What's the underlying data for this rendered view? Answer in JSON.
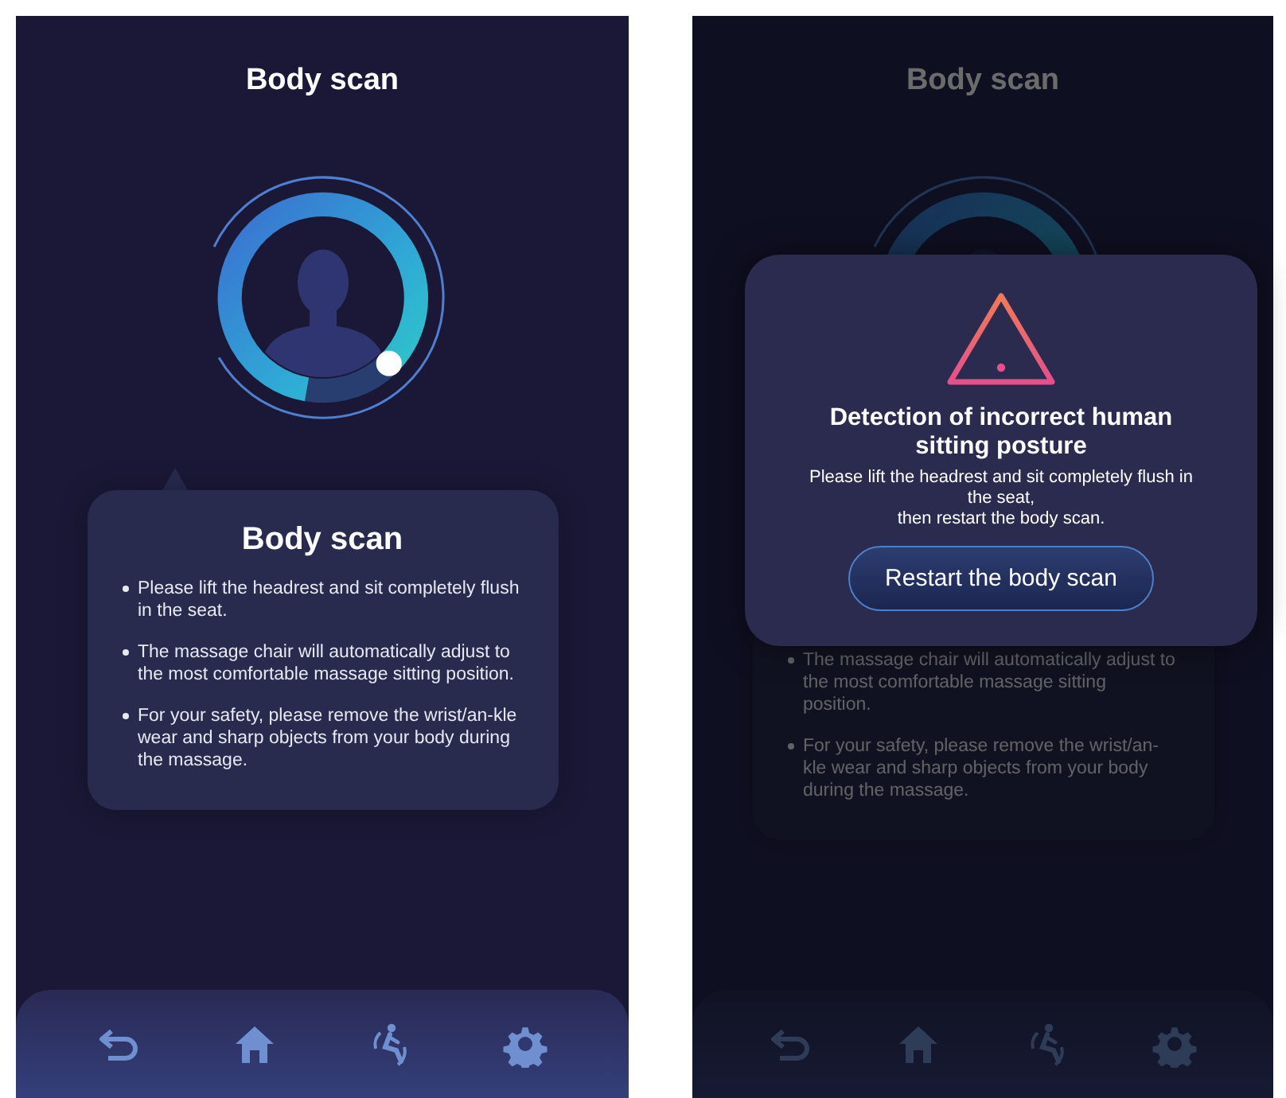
{
  "screens": [
    {
      "dimmed": false,
      "title": "Body scan",
      "tip": {
        "title": "Body scan",
        "bullets": [
          "Please lift the headrest and sit completely flush in the seat.",
          "The massage chair will automatically adjust to the most comfortable massage sitting position.",
          "For your safety, please remove the wrist/an-kle wear and sharp objects from your body during the massage."
        ]
      }
    },
    {
      "dimmed": true,
      "title": "Body scan",
      "tip": {
        "bullets": [
          "The massage chair will automatically adjust to the most comfortable massage sitting position.",
          "For your safety, please remove the wrist/an-kle wear and sharp objects from your body during the massage."
        ]
      },
      "dialog": {
        "title": "Detection of incorrect human sitting posture",
        "message": "Please lift the headrest and sit completely flush in the seat,\nthen restart the body scan.",
        "button": "Restart the body scan"
      }
    }
  ]
}
